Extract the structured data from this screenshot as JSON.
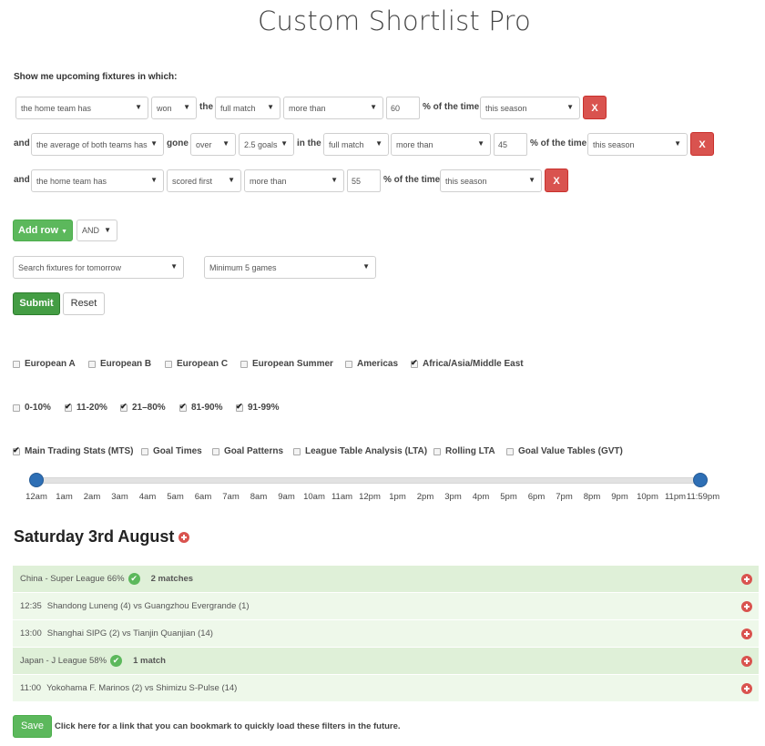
{
  "page": {
    "title": "Custom Shortlist Pro",
    "intro": "Show me upcoming fixtures in which:"
  },
  "filters": {
    "rows": [
      {
        "subject": "the home team has",
        "action": "won",
        "connector1": "the",
        "period": "full match",
        "comparison": "more than",
        "value": "60",
        "suffix": "% of the time",
        "timeframe": "this season",
        "remove_label": "X"
      },
      {
        "prefix": "and",
        "subject": "the average of both teams has",
        "verb": "gone",
        "direction": "over",
        "goals": "2.5 goals",
        "connector": "in the",
        "period": "full match",
        "comparison": "more than",
        "value": "45",
        "suffix": "% of the time",
        "timeframe": "this season",
        "remove_label": "X"
      },
      {
        "prefix": "and",
        "subject": "the home team has",
        "action": "scored first",
        "comparison": "more than",
        "value": "55",
        "suffix": "% of the time",
        "timeframe": "this season",
        "remove_label": "X"
      }
    ],
    "add_row_label": "Add row",
    "logic_operator": "AND",
    "search_scope": "Search fixtures for tomorrow",
    "minimum_games": "Minimum 5 games",
    "submit_label": "Submit",
    "reset_label": "Reset"
  },
  "regions": [
    {
      "label": "European A",
      "checked": false
    },
    {
      "label": "European B",
      "checked": false
    },
    {
      "label": "European C",
      "checked": false
    },
    {
      "label": "European Summer",
      "checked": false
    },
    {
      "label": "Americas",
      "checked": false
    },
    {
      "label": "Africa/Asia/Middle East",
      "checked": true
    }
  ],
  "percent_bands": [
    {
      "label": "0-10%",
      "checked": false
    },
    {
      "label": "11-20%",
      "checked": true
    },
    {
      "label": "21–80%",
      "checked": true
    },
    {
      "label": "81-90%",
      "checked": true
    },
    {
      "label": "91-99%",
      "checked": true
    }
  ],
  "stat_tables": [
    {
      "label": "Main Trading Stats (MTS)",
      "checked": true
    },
    {
      "label": "Goal Times",
      "checked": false
    },
    {
      "label": "Goal Patterns",
      "checked": false
    },
    {
      "label": "League Table Analysis (LTA)",
      "checked": false
    },
    {
      "label": "Rolling LTA",
      "checked": false
    },
    {
      "label": "Goal Value Tables (GVT)",
      "checked": false
    }
  ],
  "time_slider": {
    "ticks": [
      "12am",
      "1am",
      "2am",
      "3am",
      "4am",
      "5am",
      "6am",
      "7am",
      "8am",
      "9am",
      "10am",
      "11am",
      "12pm",
      "1pm",
      "2pm",
      "3pm",
      "4pm",
      "5pm",
      "6pm",
      "7pm",
      "8pm",
      "9pm",
      "10pm",
      "11pm",
      "11:59pm"
    ],
    "start": "12am",
    "end": "11:59pm"
  },
  "results": {
    "date_heading": "Saturday 3rd August",
    "groups": [
      {
        "league": "China - Super League 66%",
        "count": "2 matches",
        "matches": [
          {
            "time": "12:35",
            "fixture": "Shandong Luneng (4) vs Guangzhou Evergrande (1)"
          },
          {
            "time": "13:00",
            "fixture": "Shanghai SIPG (2) vs Tianjin Quanjian (14)"
          }
        ]
      },
      {
        "league": "Japan - J League 58%",
        "count": "1 match",
        "matches": [
          {
            "time": "11:00",
            "fixture": "Yokohama F. Marinos (2) vs Shimizu S-Pulse (14)"
          }
        ]
      }
    ]
  },
  "footer": {
    "save_label": "Save",
    "save_note": "Click here for a link that you can bookmark to quickly load these filters in the future."
  }
}
